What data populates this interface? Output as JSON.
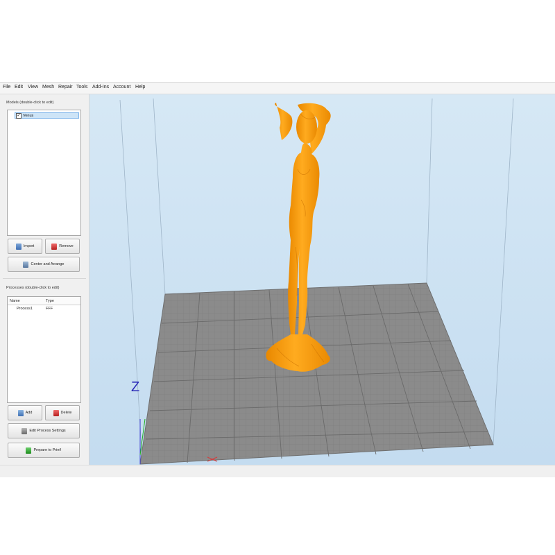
{
  "menu": [
    "File",
    "Edit",
    "View",
    "Mesh",
    "Repair",
    "Tools",
    "Add-Ins",
    "Account",
    "Help"
  ],
  "models_panel": {
    "label": "Models (double-click to edit)",
    "items": [
      {
        "name": "Venus",
        "checked": true
      }
    ],
    "import_label": "Import",
    "remove_label": "Remove",
    "center_label": "Center and Arrange"
  },
  "processes_panel": {
    "label": "Processes (double-click to edit)",
    "col_name": "Name",
    "col_type": "Type",
    "rows": [
      {
        "name": "Process1",
        "type": "FFF"
      }
    ],
    "add_label": "Add",
    "delete_label": "Delete",
    "edit_label": "Edit Process Settings",
    "prepare_label": "Prepare to Print!"
  },
  "viewport": {
    "axis_z_label": "Z",
    "model_color": "#ff9f0a",
    "bed_color": "#8b8b8b"
  }
}
